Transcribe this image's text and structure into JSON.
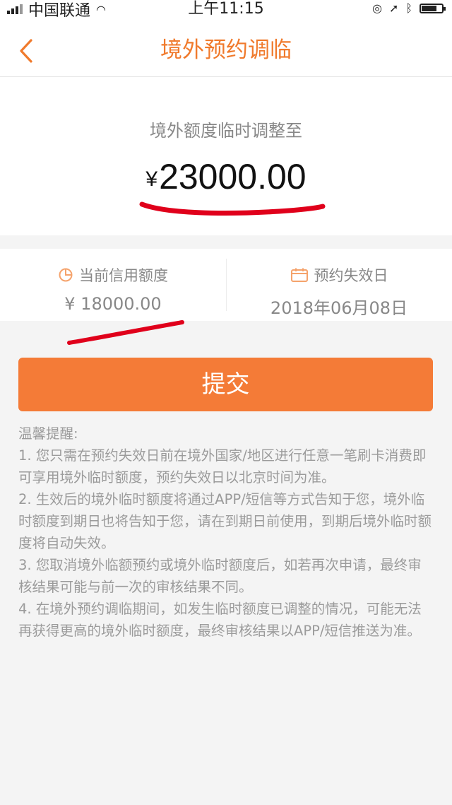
{
  "status_bar": {
    "carrier": "中国联通",
    "time": "上午11:15"
  },
  "nav": {
    "title": "境外预约调临",
    "back_icon": "chevron-left-icon"
  },
  "amount": {
    "label": "境外额度临时调整至",
    "currency": "¥",
    "value": "23000.00"
  },
  "info": {
    "current_limit_label": "当前信用额度",
    "current_limit_value": "¥ 18000.00",
    "current_limit_icon": "pie-chart-icon",
    "expiry_label": "预约失效日",
    "expiry_value": "2018年06月08日",
    "expiry_icon": "calendar-icon"
  },
  "submit_label": "提交",
  "tips": {
    "title": "温馨提醒:",
    "items": [
      "1. 您只需在预约失效日前在境外国家/地区进行任意一笔刷卡消费即可享用境外临时额度，预约失效日以北京时间为准。",
      "2. 生效后的境外临时额度将通过APP/短信等方式告知于您，境外临时额度到期日也将告知于您，请在到期日前使用，到期后境外临时额度将自动失效。",
      "3. 您取消境外临额预约或境外临时额度后，如若再次申请，最终审核结果可能与前一次的审核结果不同。",
      "4. 在境外预约调临期间，如发生临时额度已调整的情况，可能无法再获得更高的境外临时额度，最终审核结果以APP/短信推送为准。"
    ]
  },
  "colors": {
    "accent": "#f07a2c",
    "button": "#f47b37",
    "annotation": "#e0001b"
  }
}
